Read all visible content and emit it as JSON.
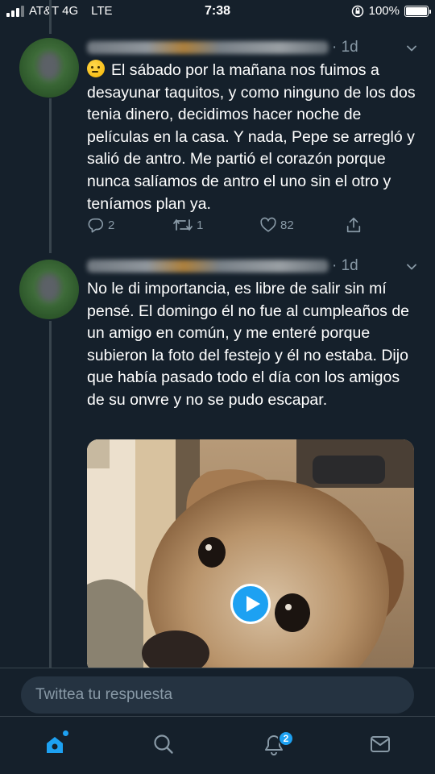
{
  "status_bar": {
    "carrier": "AT&T 4G",
    "network": "LTE",
    "time": "7:38",
    "battery": "100%",
    "battery_level": 1.0
  },
  "tweets": [
    {
      "time": "· 1d",
      "emoji_icon": "thinking-face-emoji",
      "text": "El sábado por la mañana nos fuimos a desayunar taquitos, y como ninguno de los dos tenia dinero, decidimos hacer noche de películas en la casa. Y nada, Pepe se arregló y salió de antro. Me partió el corazón porque nunca salíamos de antro el uno sin el otro y teníamos plan ya.",
      "reply_count": "2",
      "retweet_count": "1",
      "like_count": "82"
    },
    {
      "time": "· 1d",
      "text": "No le di importancia, es libre de salir sin mí pensé. El domingo él no fue al cumpleaños de un amigo en común, y me enteré porque subieron la foto del festejo y él no estaba. Dijo que había pasado todo el día con los amigos de su onvre y no se pudo escapar.",
      "media_type": "video",
      "media_icon": "play-icon"
    }
  ],
  "reply_bar": {
    "placeholder": "Twittea tu respuesta"
  },
  "tab_bar": {
    "notifications_badge": "2",
    "tabs": [
      "home-icon",
      "search-icon",
      "notifications-icon",
      "messages-icon"
    ]
  },
  "colors": {
    "background": "#15202b",
    "accent": "#1da1f2",
    "muted": "#8899a6",
    "divider": "#38444d"
  }
}
